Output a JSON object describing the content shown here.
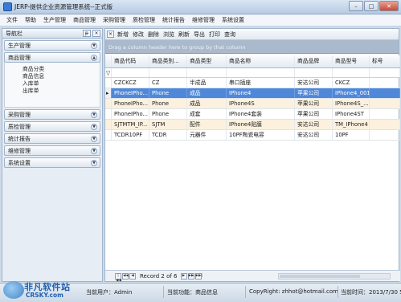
{
  "window": {
    "title": "JERP-提供企业资源管理系统--正式版",
    "buttons": {
      "minimize": "–",
      "maximize": "□",
      "close": "✕"
    }
  },
  "menu": [
    "文件",
    "帮助",
    "生产管理",
    "商品管理",
    "采购管理",
    "质检管理",
    "统计报告",
    "维修管理",
    "系统设置"
  ],
  "nav": {
    "title": "导航栏",
    "pin_label": "ᵽ",
    "close_label": "×",
    "groups_top": [
      {
        "label": "生产管理"
      },
      {
        "label": "商品管理",
        "expanded": true
      }
    ],
    "sub_items": [
      "商品分类",
      "商品信息",
      "入库单",
      "出库单"
    ],
    "groups_bottom": [
      {
        "label": "采购管理"
      },
      {
        "label": "质检管理"
      },
      {
        "label": "统计报告"
      },
      {
        "label": "维修管理"
      },
      {
        "label": "系统设置"
      }
    ]
  },
  "toolbar": {
    "close_label": "×",
    "buttons": [
      "新增",
      "修改",
      "删除",
      "浏览",
      "刷新",
      "导出",
      "打印",
      "查询"
    ]
  },
  "grid": {
    "group_panel_text": "Drag a column header here to group by that column",
    "columns": [
      "商品代码",
      "商品类别...",
      "商品类型",
      "商品名称",
      "商品品牌",
      "商品型号",
      "标号"
    ],
    "filter_icon": "▽",
    "row_indicator": "▸",
    "rows": [
      [
        "CZCKCZ",
        "CZ",
        "半成品",
        "串口插座",
        "安达公司",
        "CKCZ",
        ""
      ],
      [
        "PhoneIPho...",
        "Phone",
        "成品",
        "IPhone4",
        "苹果公司",
        "IPhone4_001",
        ""
      ],
      [
        "PhoneIPho...",
        "Phone",
        "成品",
        "IPhone4S",
        "苹果公司",
        "IPhone4S_...",
        ""
      ],
      [
        "PhoneIPho...",
        "Phone",
        "成套",
        "IPhone4套装",
        "苹果公司",
        "IPhone4ST",
        ""
      ],
      [
        "SJTMTM_IP...",
        "SJTM",
        "配件",
        "IPhone4贴膜",
        "安达公司",
        "TM_IPhone4",
        ""
      ],
      [
        "TCDR10PF",
        "TCDR",
        "元器件",
        "10PF陶瓷电容",
        "安达公司",
        "10PF",
        ""
      ]
    ],
    "selected_row": 1
  },
  "pager": {
    "record_text": "Record 2 of 6",
    "buttons": [
      "|◀◀",
      "◀◀",
      "◀",
      "▶",
      "▶▶",
      "▶▶|"
    ]
  },
  "status": {
    "current_user_label": "当前用户：Admin",
    "current_function_label": "当前功能：商品信息",
    "copyright": "CopyRight: zhhot@hotmail.com",
    "time_label": "当前时间：2013/7/30 5"
  },
  "watermark": {
    "text_cn": "非凡软件站",
    "text_en": "CRSKY.com"
  },
  "colors": {
    "selected_row": "#4f88d8",
    "alt_row": "#fbf1de",
    "group_panel": "#aab9cb"
  }
}
